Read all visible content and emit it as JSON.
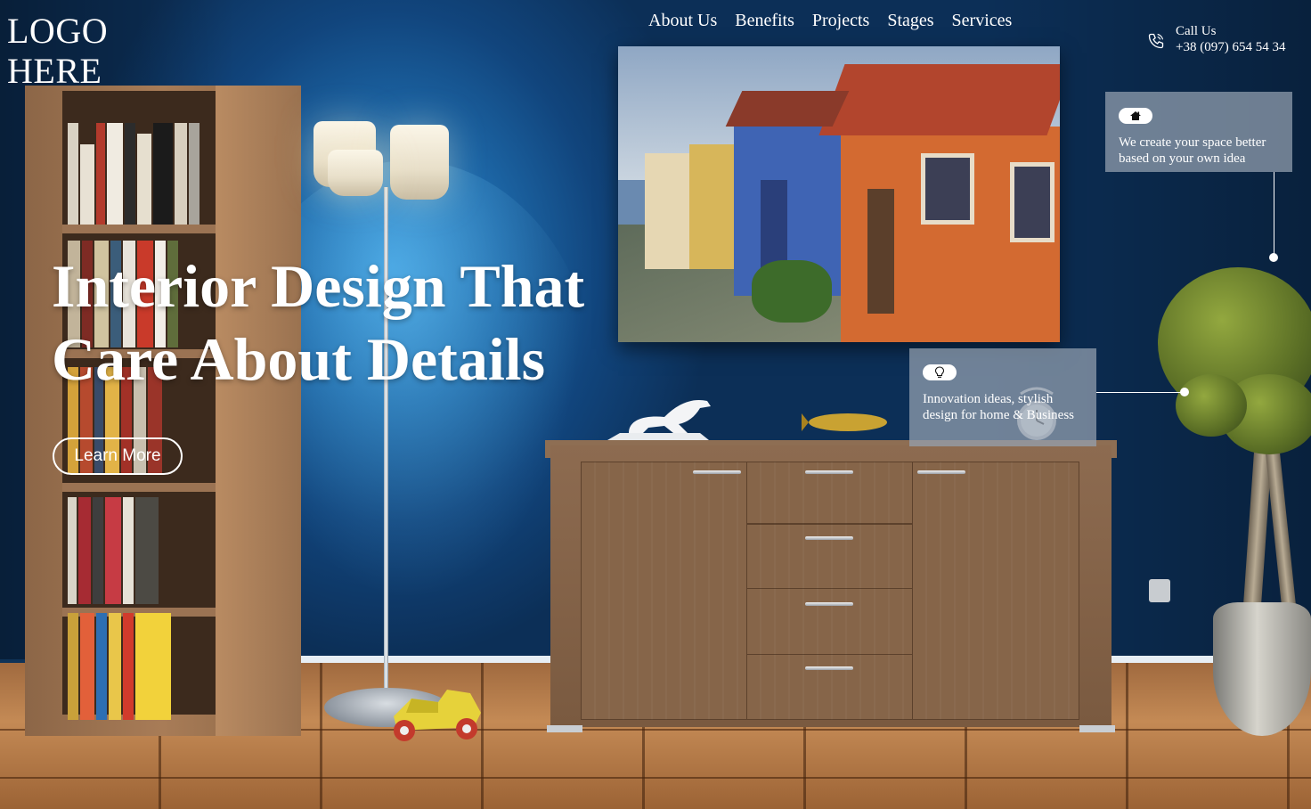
{
  "logo": {
    "line1": "LOGO",
    "line2": "HERE"
  },
  "nav": {
    "items": [
      {
        "label": "About Us"
      },
      {
        "label": "Benefits"
      },
      {
        "label": "Projects"
      },
      {
        "label": "Stages"
      },
      {
        "label": "Services"
      }
    ]
  },
  "contact": {
    "label": "Call Us",
    "phone": "+38 (097) 654 54 34"
  },
  "hero": {
    "title_line1": "Interior Design That",
    "title_line2": "Care About Details",
    "cta_label": "Learn More"
  },
  "cards": [
    {
      "icon": "house-icon",
      "text": "We create your space better based on your own idea"
    },
    {
      "icon": "lightbulb-icon",
      "text": "Innovation ideas, stylish design for home & Business"
    }
  ],
  "colors": {
    "wall": "#11457d",
    "card_bg": "#96a2b2",
    "text": "#ffffff"
  }
}
